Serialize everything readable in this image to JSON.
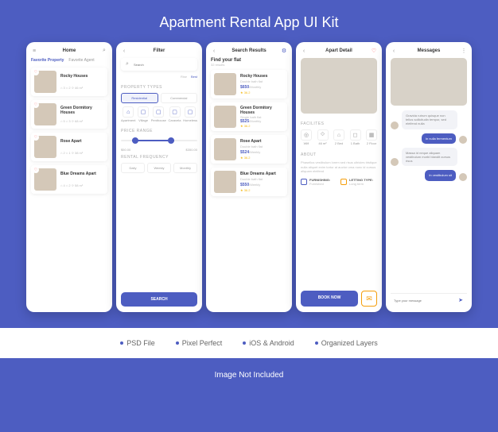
{
  "title": "Apartment Rental App UI Kit",
  "features": [
    "PSD File",
    "Pixel Perfect",
    "iOS & Android",
    "Organized Layers"
  ],
  "footer": "Image Not Included",
  "screens": {
    "home": {
      "title": "Home",
      "tabs": [
        "Favorite Property",
        "Favorite Agent"
      ],
      "items": [
        {
          "name": "Rocky Houses",
          "meta": "⌂ 3  ⌂ 2  ⟐ 46 m²"
        },
        {
          "name": "Green Dormitory Houses",
          "meta": "⌂ 5  ⌂ 3  ⟐ 68 m²"
        },
        {
          "name": "Rose Apart",
          "meta": "⌂ 2  ⌂ 1  ⟐ 38 m²"
        },
        {
          "name": "Blue Dreams Apart",
          "meta": "⌂ 4  ⌂ 2  ⟐ 58 m²"
        }
      ]
    },
    "filter": {
      "title": "Filter",
      "search": "Search",
      "sort": [
        "Rise",
        "Best"
      ],
      "sec1": "PROPERTY TYPES",
      "propTypes": [
        "Residential",
        "Commercial"
      ],
      "propSub": [
        "Apartment",
        "Village",
        "Penthouse",
        "Caravela",
        "Homeless"
      ],
      "sec2": "PRICE RANGE",
      "prices": {
        "min": "$50.00",
        "max": "$350.00"
      },
      "sec3": "RENTAL FREQUENCY",
      "freq": [
        "Daily",
        "Weekly",
        "Monthly"
      ],
      "btn": "SEARCH"
    },
    "results": {
      "title": "Search Results",
      "heading": "Find your flat",
      "count": "32 results",
      "items": [
        {
          "name": "Rocky Houses",
          "sub": "Double bath flat",
          "price": "$650",
          "unit": "/Monthly",
          "rating": "36.2"
        },
        {
          "name": "Green Dormitory Houses",
          "sub": "Single bath flat",
          "price": "$525",
          "unit": "/Monthly",
          "rating": "36.2"
        },
        {
          "name": "Rose Apart",
          "sub": "Double bath flat",
          "price": "$524",
          "unit": "/Weekly",
          "rating": "36.2"
        },
        {
          "name": "Blue Dreams Apart",
          "sub": "Double bath flat",
          "price": "$550",
          "unit": "/Weekly",
          "rating": "36.2"
        }
      ]
    },
    "detail": {
      "title": "Apart Detail",
      "sec1": "FACILITES",
      "fac": [
        {
          "icon": "◎",
          "label": "Wifi"
        },
        {
          "icon": "⟐",
          "label": "46 m²"
        },
        {
          "icon": "⌂",
          "label": "2 Bed"
        },
        {
          "icon": "◻",
          "label": "1 Bath"
        },
        {
          "icon": "▦",
          "label": "2 Floor"
        }
      ],
      "sec2": "ABOUT",
      "about": "Phasellus vestibulum lorem sed risus ultricies tristique nulla aliquet enim tortor at auctor urna nunc id cursus aliquam eleifend",
      "furn": {
        "label": "FURNISHING:",
        "val": "Furnished"
      },
      "let": {
        "label": "LETTING TYPE:",
        "val": "Long term"
      },
      "btn": "BOOK NOW"
    },
    "messages": {
      "title": "Messages",
      "msgs": [
        {
          "me": false,
          "text": "Gravida rutrum quisque non tellus sollicitudin tempor, sed eleifend nulla"
        },
        {
          "me": true,
          "text": "In nulla fermentum"
        },
        {
          "me": false,
          "text": "Massa id neque aliquam vestibulum morbi blandit cursus risus"
        },
        {
          "me": true,
          "text": "In vestibulum sit"
        }
      ],
      "placeholder": "Type your message"
    }
  }
}
